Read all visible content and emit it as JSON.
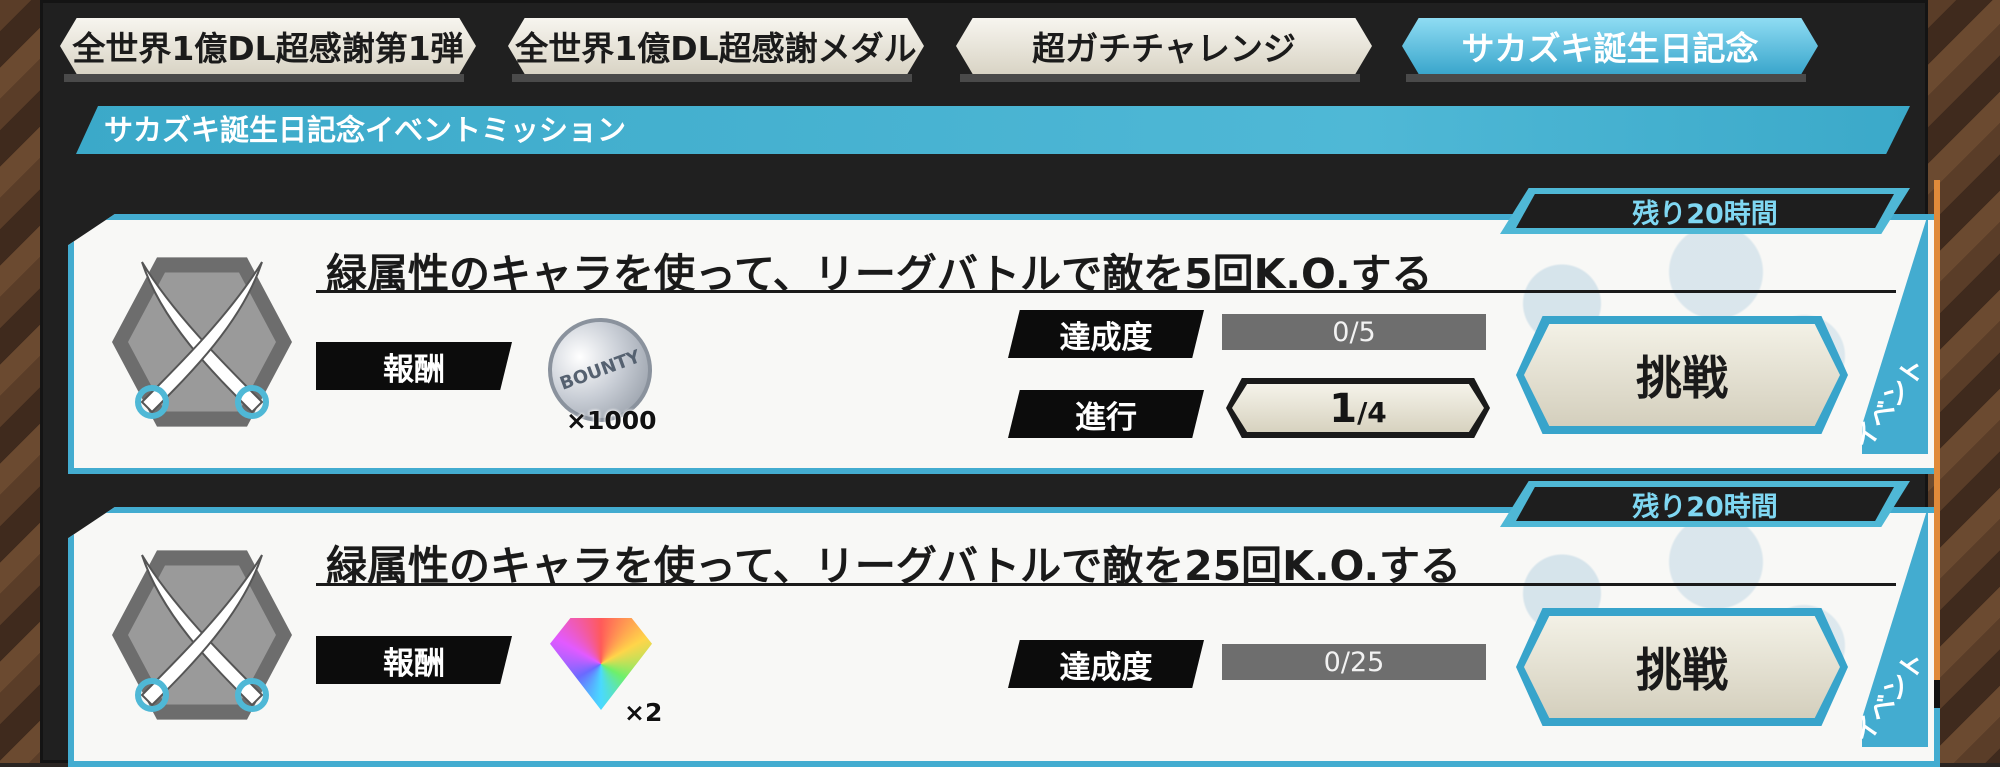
{
  "tabs": [
    {
      "label": "全世界1億DL超感謝第1弾",
      "active": false
    },
    {
      "label": "全世界1億DL超感謝メダル",
      "active": false
    },
    {
      "label": "超ガチチャレンジ",
      "active": false
    },
    {
      "label": "サカズキ誕生日記念",
      "active": true
    }
  ],
  "section": {
    "title": "サカズキ誕生日記念イベントミッション"
  },
  "missions": [
    {
      "remaining": "残り20時間",
      "title": "緑属性のキャラを使って、リーグバトルで敵を5回K.O.する",
      "reward_label": "報酬",
      "reward_icon": "bounty-coin-icon",
      "reward_coin_text": "BOUNTY",
      "reward_qty": "×1000",
      "achievement_label": "達成度",
      "achievement_value": "0/5",
      "progress_label": "進行",
      "step_current": "1",
      "step_total": "/4",
      "button_label": "挑戦",
      "badge": "イベント"
    },
    {
      "remaining": "残り20時間",
      "title": "緑属性のキャラを使って、リーグバトルで敵を25回K.O.する",
      "reward_label": "報酬",
      "reward_icon": "rainbow-gem-icon",
      "reward_qty": "×2",
      "achievement_label": "達成度",
      "achievement_value": "0/25",
      "button_label": "挑戦",
      "badge": "イベント"
    }
  ],
  "colors": {
    "accent": "#43acd0",
    "active_tab": "#4fb8d6",
    "label_bg": "#0c0c0c"
  }
}
